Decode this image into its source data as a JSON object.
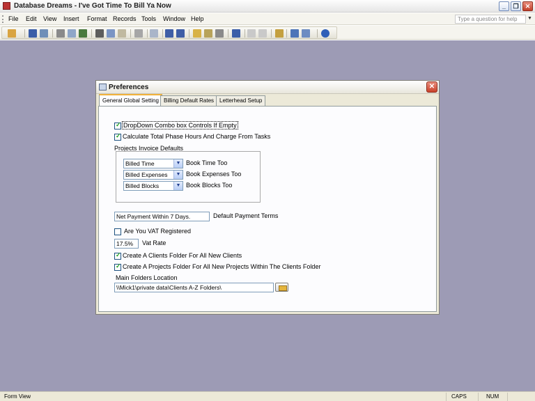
{
  "window": {
    "title": "Database Dreams - I've Got Time To Bill Ya Now",
    "minimize_icon": "minimize-icon",
    "restore_icon": "restore-icon",
    "close_icon": "close-icon"
  },
  "menu": {
    "items": [
      "File",
      "Edit",
      "View",
      "Insert",
      "Format",
      "Records",
      "Tools",
      "Window",
      "Help"
    ],
    "ask_placeholder": "Type a question for help"
  },
  "dialog": {
    "title": "Preferences",
    "tabs": [
      "General Global Setting",
      "Billing Default Rates",
      "Letterhead Setup"
    ],
    "dropdown_combo_label": "DropDown Combo box Controls If Empty",
    "dropdown_combo_checked": true,
    "calc_phase_label": "Calculate Total Phase Hours And Charge From Tasks",
    "calc_phase_checked": true,
    "invoice_group_label": "Projects Invoice Defaults",
    "invoice_rows": [
      {
        "combo": "Billed Time",
        "label": "Book Time Too"
      },
      {
        "combo": "Billed Expenses",
        "label": "Book Expenses Too"
      },
      {
        "combo": "Billed Blocks",
        "label": "Book Blocks Too"
      }
    ],
    "payment_terms_value": "Net Payment Within 7 Days.",
    "payment_terms_label": "Default Payment Terms",
    "vat_registered_label": "Are You VAT Registered",
    "vat_registered_checked": false,
    "vat_rate_value": "17.5%",
    "vat_rate_label": "Vat Rate",
    "clients_folder_label": "Create A Clients Folder For All New Clients",
    "clients_folder_checked": true,
    "projects_folder_label": "Create A Projects Folder For All New Projects Within The Clients Folder",
    "projects_folder_checked": true,
    "main_folders_label": "Main Folders Location",
    "main_folders_value": "\\\\Mick1\\private data\\Clients A-Z Folders\\"
  },
  "status": {
    "left": "Form View",
    "caps": "CAPS",
    "num": "NUM"
  },
  "colors": {
    "workspace": "#9d9bb5",
    "dialog_bg": "#ece9d8",
    "tab_highlight": "#f2b23a"
  }
}
